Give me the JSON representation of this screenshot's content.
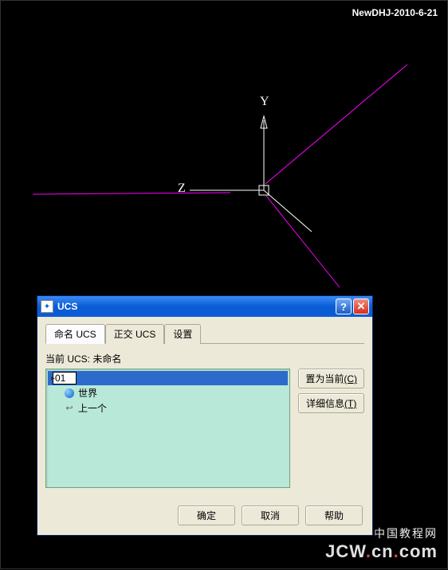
{
  "watermark": {
    "top": "NewDHJ-2010-6-21",
    "bottom_cn": "中国教程网",
    "bottom_url_a": "JCW",
    "bottom_url_b": "cn",
    "bottom_url_c": "com"
  },
  "axes": {
    "y_label": "Y",
    "z_label": "Z"
  },
  "dialog": {
    "title": "UCS",
    "tabs": [
      {
        "label": "命名 UCS",
        "active": true
      },
      {
        "label": "正交 UCS",
        "active": false
      },
      {
        "label": "设置",
        "active": false
      }
    ],
    "current_label": "当前 UCS:",
    "current_value": "未命名",
    "tree": {
      "editing_value": "01",
      "items": [
        {
          "icon": "globe",
          "label": "世界"
        },
        {
          "icon": "prev",
          "label": "上一个"
        }
      ]
    },
    "side_buttons": {
      "set_current": "置为当前",
      "set_current_key": "(C)",
      "details": "详细信息",
      "details_key": "(T)"
    },
    "bottom_buttons": {
      "ok": "确定",
      "cancel": "取消",
      "help": "帮助"
    }
  }
}
